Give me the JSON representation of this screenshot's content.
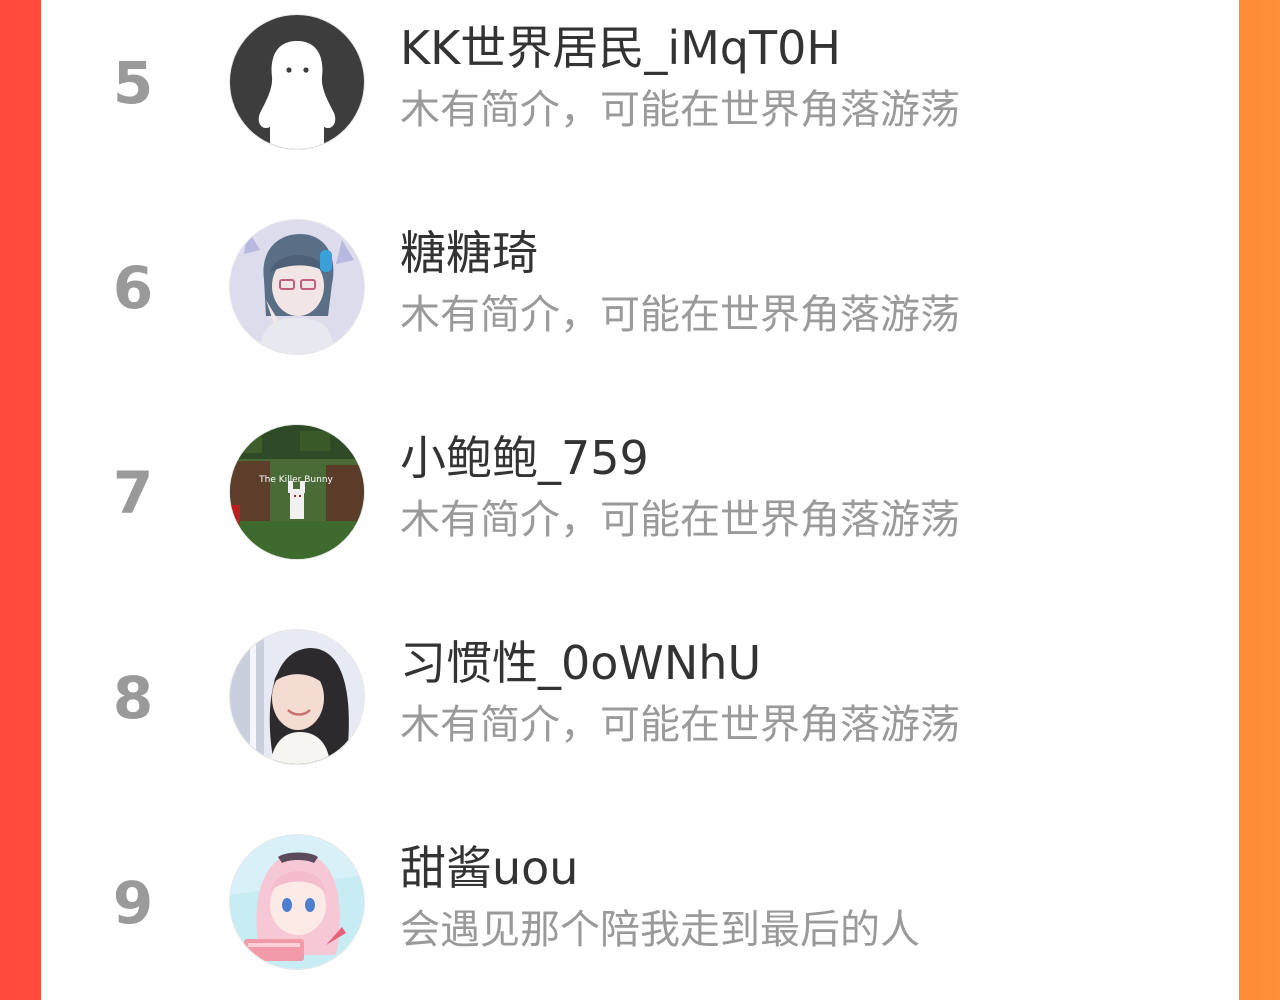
{
  "colors": {
    "background_left": "#ff4a3d",
    "background_right": "#ff8f38",
    "panel": "#ffffff",
    "rank_text": "#9a9a9a",
    "name_text": "#333333",
    "bio_text": "#9a9a9a"
  },
  "ranking": {
    "items": [
      {
        "rank": "5",
        "name": "KK世界居民_iMqT0H",
        "bio": "木有简介，可能在世界角落游荡",
        "avatar": "default-ghost-avatar"
      },
      {
        "rank": "6",
        "name": "糖糖琦",
        "bio": "木有简介，可能在世界角落游荡",
        "avatar": "anime-headphones-avatar"
      },
      {
        "rank": "7",
        "name": "小鲍鲍_759",
        "bio": "木有简介，可能在世界角落游荡",
        "avatar": "minecraft-bunny-avatar",
        "avatar_caption": "The Killer Bunny"
      },
      {
        "rank": "8",
        "name": "习惯性_0oWNhU",
        "bio": "木有简介，可能在世界角落游荡",
        "avatar": "girl-photo-avatar"
      },
      {
        "rank": "9",
        "name": "甜酱uou",
        "bio": "会遇见那个陪我走到最后的人",
        "avatar": "anime-pink-hair-avatar"
      }
    ]
  }
}
